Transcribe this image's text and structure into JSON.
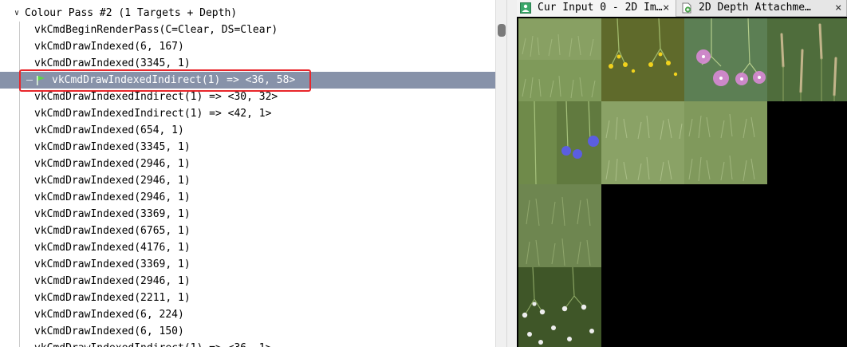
{
  "event_tree": {
    "pass_label": "Colour Pass #2 (1 Targets + Depth)",
    "events": [
      {
        "label": "vkCmdBeginRenderPass(C=Clear, DS=Clear)"
      },
      {
        "label": "vkCmdDrawIndexed(6, 167)"
      },
      {
        "label": "vkCmdDrawIndexed(3345, 1)"
      },
      {
        "label": "vkCmdDrawIndexedIndirect(1) => <36, 58>",
        "selected": true
      },
      {
        "label": "vkCmdDrawIndexedIndirect(1) => <30, 32>"
      },
      {
        "label": "vkCmdDrawIndexedIndirect(1) => <42, 1>"
      },
      {
        "label": "vkCmdDrawIndexed(654, 1)"
      },
      {
        "label": "vkCmdDrawIndexed(3345, 1)"
      },
      {
        "label": "vkCmdDrawIndexed(2946, 1)"
      },
      {
        "label": "vkCmdDrawIndexed(2946, 1)"
      },
      {
        "label": "vkCmdDrawIndexed(2946, 1)"
      },
      {
        "label": "vkCmdDrawIndexed(3369, 1)"
      },
      {
        "label": "vkCmdDrawIndexed(6765, 1)"
      },
      {
        "label": "vkCmdDrawIndexed(4176, 1)"
      },
      {
        "label": "vkCmdDrawIndexed(3369, 1)"
      },
      {
        "label": "vkCmdDrawIndexed(2946, 1)"
      },
      {
        "label": "vkCmdDrawIndexed(2211, 1)"
      },
      {
        "label": "vkCmdDrawIndexed(6, 224)"
      },
      {
        "label": "vkCmdDrawIndexed(6, 150)"
      },
      {
        "label": "vkCmdDrawIndexedIndirect(1) => <36, 1>"
      }
    ]
  },
  "texture_viewer": {
    "tabs": [
      {
        "label": "Cur Input 0 - 2D Im…",
        "icon": "image-icon",
        "closable": true
      },
      {
        "label": "2D Depth Attachme…",
        "icon": "depth-attachment-icon",
        "closable": true
      }
    ],
    "close_glyph": "×"
  },
  "colors": {
    "selection": "#8792a9",
    "highlight_box": "#e8262b",
    "texture_background": "#000000"
  }
}
